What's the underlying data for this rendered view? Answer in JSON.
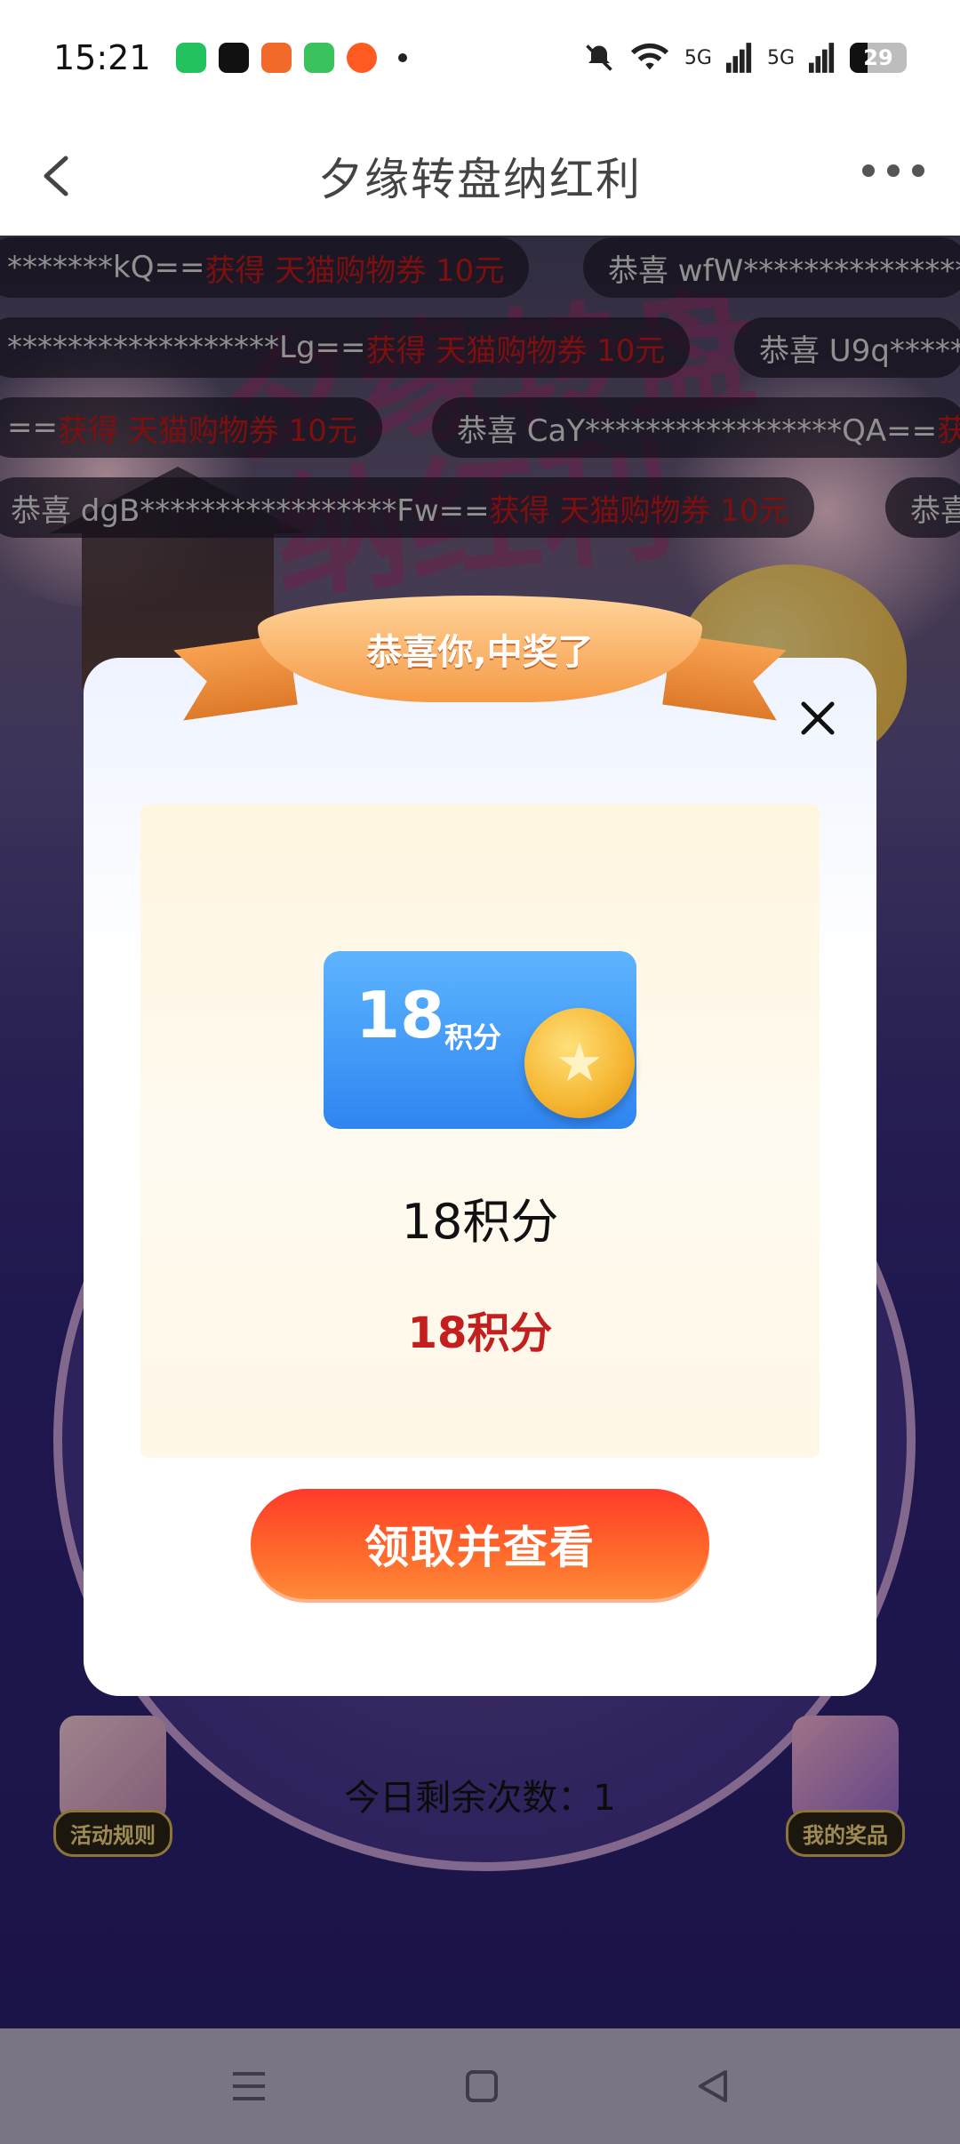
{
  "status_bar": {
    "time": "15:21",
    "apps": [
      "wechat-icon",
      "tiktok-icon",
      "pumpkin-app-icon",
      "messages-icon",
      "orange-app-icon"
    ],
    "signal_labels": [
      "5G",
      "5G"
    ],
    "battery": "29"
  },
  "nav": {
    "title": "夕缘转盘纳红利"
  },
  "background": {
    "title_art_line1": "夕缘转盘",
    "title_art_line2": "纳红利"
  },
  "marquee": [
    {
      "text": "*******kQ== ",
      "win": "获得 天猫购物券 10元"
    },
    {
      "text": "恭喜 wfW***************",
      "win": ""
    },
    {
      "text": "******************Lg== ",
      "win": "获得 天猫购物券 10元"
    },
    {
      "text": "恭喜 U9q*****",
      "win": ""
    },
    {
      "text": "== ",
      "win": "获得 天猫购物券 10元"
    },
    {
      "text": "恭喜 CaY*****************QA== ",
      "win": "获"
    },
    {
      "text": "恭喜 dgB*****************Fw== ",
      "win": "获得 天猫购物券 10元"
    },
    {
      "text": "恭喜",
      "win": ""
    }
  ],
  "bottom": {
    "remaining": "今日剩余次数：1",
    "rules_label": "活动规则",
    "prizes_label": "我的奖品"
  },
  "modal": {
    "ribbon_text": "恭喜你,中奖了",
    "prize_card_number": "18",
    "prize_card_unit": "积分",
    "prize_name": "18积分",
    "prize_value": "18积分",
    "claim_button": "领取并查看"
  },
  "colors": {
    "accent_red": "#c41f1f",
    "button_gradient_start": "#ff3b2a",
    "card_blue": "#2f85f0"
  }
}
